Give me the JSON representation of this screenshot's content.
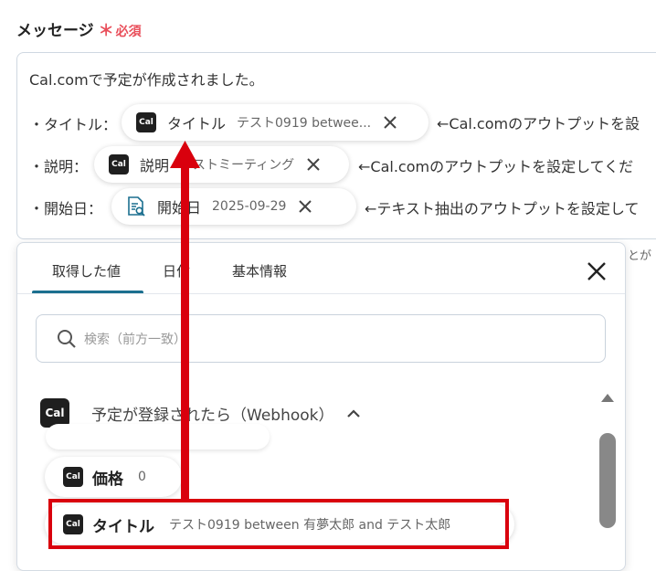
{
  "field": {
    "label": "メッセージ",
    "required_star": "＊",
    "required_text": "必須"
  },
  "message": {
    "line1": "Cal.comで予定が作成されました。",
    "title_prefix": "・タイトル：",
    "desc_prefix": "・説明：",
    "date_prefix": "・開始日："
  },
  "chips": {
    "title": {
      "icon": "Cal",
      "label": "タイトル",
      "value": "テスト0919 betwee...",
      "after": "←Cal.comのアウトプットを設"
    },
    "desc": {
      "icon": "Cal",
      "label": "説明",
      "value": "テストミーティング",
      "after": "←Cal.comのアウトプットを設定してくだ"
    },
    "date": {
      "label": "開始日",
      "value": "2025-09-29",
      "after": "←テキスト抽出のアウトプットを設定して"
    }
  },
  "background_hint": "とが",
  "popup": {
    "tabs": [
      {
        "label": "取得した値"
      },
      {
        "label": "日付"
      },
      {
        "label": "基本情報"
      }
    ],
    "search_placeholder": "検索（前方一致）",
    "group": {
      "icon": "Cal",
      "label": "予定が登録されたら（Webhook）"
    },
    "items": [
      {
        "icon": "Cal",
        "label": "価格",
        "value": "0"
      },
      {
        "icon": "Cal",
        "label": "タイトル",
        "value": "テスト0919 between 有夢太郎 and テスト太郎"
      }
    ]
  },
  "colors": {
    "accent": "#1b6f8f",
    "required": "#e94e5a",
    "highlight": "#d9000d"
  }
}
